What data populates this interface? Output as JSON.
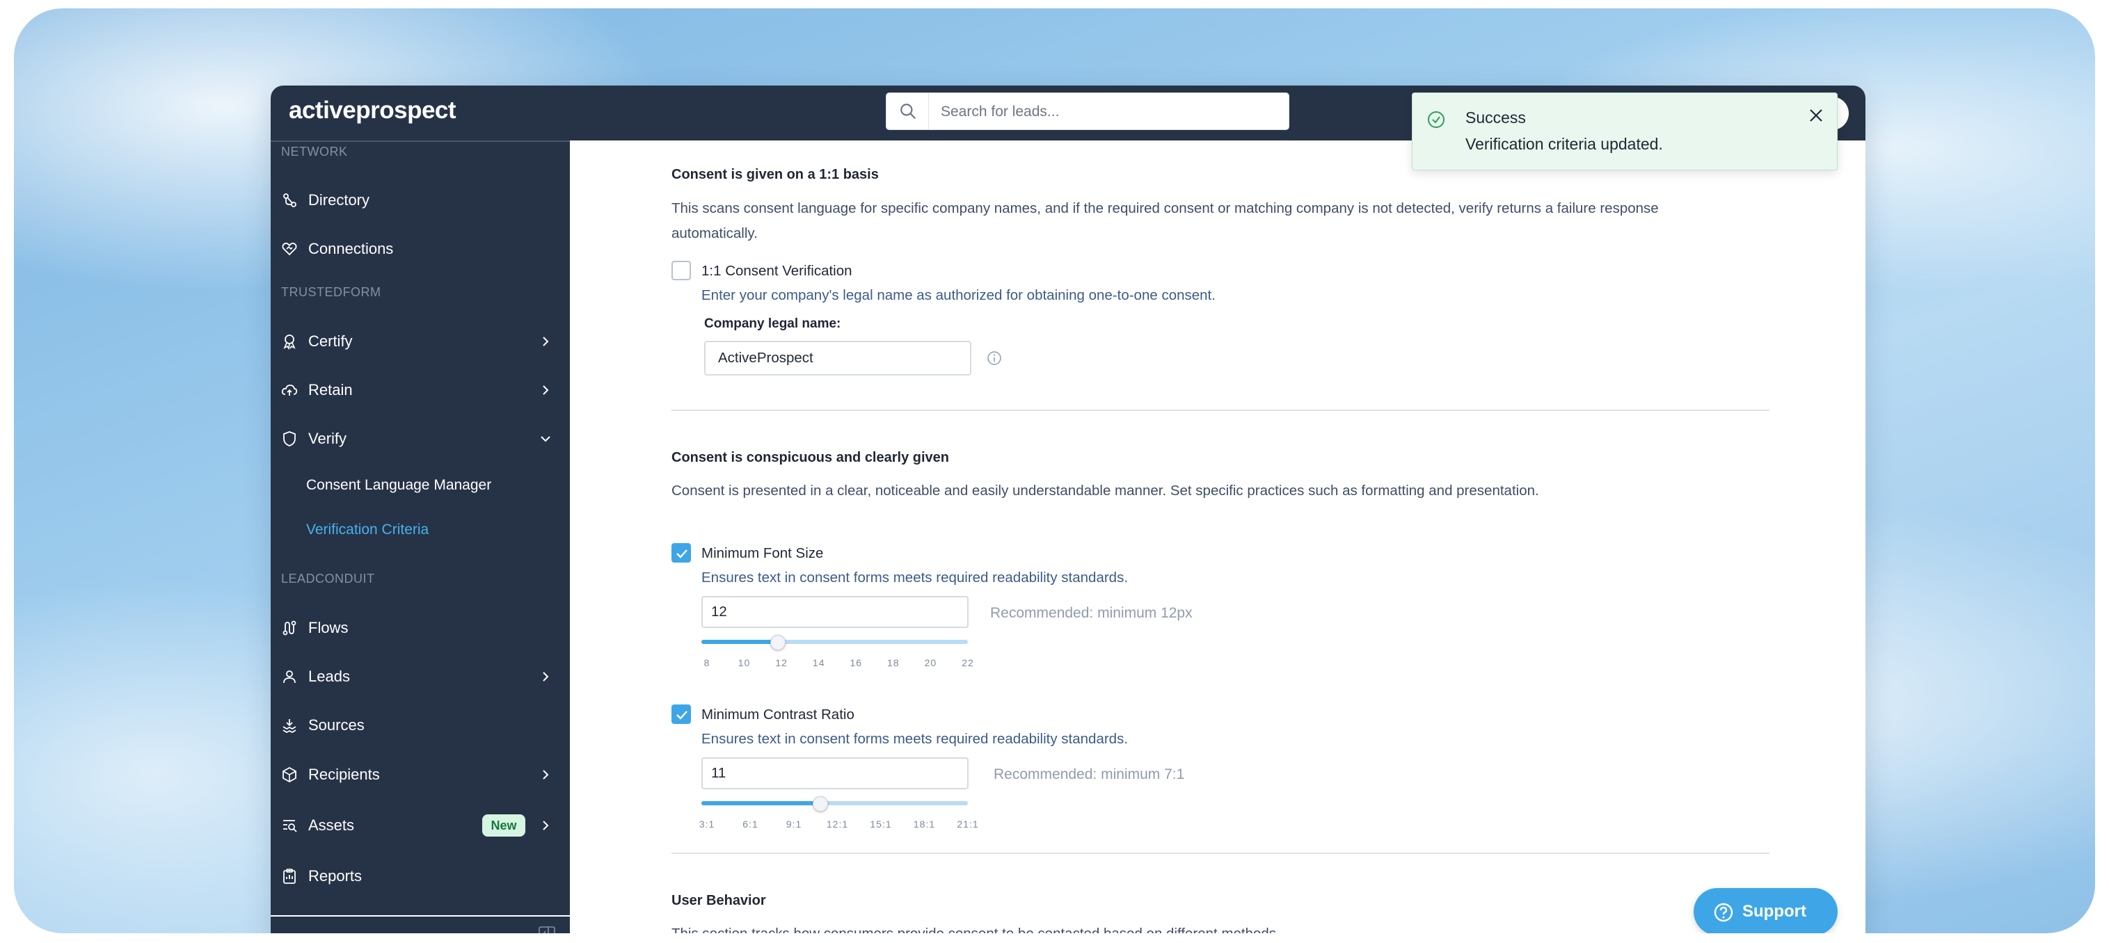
{
  "app": {
    "logo_text": "activeprospect",
    "search_placeholder": "Search for leads..."
  },
  "sidebar": {
    "sections": [
      {
        "label": "NETWORK"
      },
      {
        "label": "TRUSTEDFORM"
      },
      {
        "label": "LEADCONDUIT"
      }
    ],
    "items": {
      "directory": {
        "label": "Directory",
        "icon": "directory-icon"
      },
      "connections": {
        "label": "Connections",
        "icon": "connections-icon"
      },
      "certify": {
        "label": "Certify",
        "icon": "certify-icon"
      },
      "retain": {
        "label": "Retain",
        "icon": "retain-icon"
      },
      "verify": {
        "label": "Verify",
        "icon": "verify-icon"
      },
      "flows": {
        "label": "Flows",
        "icon": "flows-icon"
      },
      "leads": {
        "label": "Leads",
        "icon": "leads-icon"
      },
      "sources": {
        "label": "Sources",
        "icon": "sources-icon"
      },
      "recipients": {
        "label": "Recipients",
        "icon": "recipients-icon"
      },
      "assets": {
        "label": "Assets",
        "icon": "assets-icon",
        "badge": "New"
      },
      "reports": {
        "label": "Reports",
        "icon": "reports-icon"
      }
    },
    "verify_sub": {
      "consent_language_manager": "Consent Language Manager",
      "verification_criteria": "Verification Criteria"
    }
  },
  "content": {
    "one_to_one": {
      "heading": "Consent is given on a 1:1 basis",
      "description": "This scans consent language for specific company names, and if the required consent or matching company is not detected, verify returns a failure response automatically.",
      "checkbox_label": "1:1 Consent Verification",
      "checked": false,
      "hint": "Enter your company's legal name as authorized for obtaining one-to-one consent.",
      "field_label": "Company legal name:",
      "field_value": "ActiveProspect"
    },
    "conspicuous": {
      "heading": "Consent is conspicuous and clearly given",
      "description": "Consent is presented in a clear, noticeable and easily understandable manner. Set specific practices such as formatting and presentation.",
      "font_size": {
        "label": "Minimum Font Size",
        "checked": true,
        "hint": "Ensures text in consent forms meets required readability standards.",
        "value": "12",
        "recommendation": "Recommended: minimum 12px",
        "ticks": [
          "8",
          "10",
          "12",
          "14",
          "16",
          "18",
          "20",
          "22"
        ],
        "min": 8,
        "max": 22,
        "current": 12
      },
      "contrast": {
        "label": "Minimum Contrast Ratio",
        "checked": true,
        "hint": "Ensures text in consent forms meets required readability standards.",
        "value": "11",
        "recommendation": "Recommended: minimum 7:1",
        "ticks": [
          "3:1",
          "6:1",
          "9:1",
          "12:1",
          "15:1",
          "18:1",
          "21:1"
        ],
        "min": 3,
        "max": 21,
        "current": 11
      }
    },
    "user_behavior": {
      "heading": "User Behavior",
      "description": "This section tracks how consumers provide consent to be contacted based on different methods."
    }
  },
  "toast": {
    "title": "Success",
    "message": "Verification criteria updated.",
    "status_color": "#2e9e5b"
  },
  "support": {
    "label": "Support"
  },
  "colors": {
    "sidebar_bg": "#263347",
    "accent": "#3ea6e6",
    "active_link": "#48b0ec"
  }
}
